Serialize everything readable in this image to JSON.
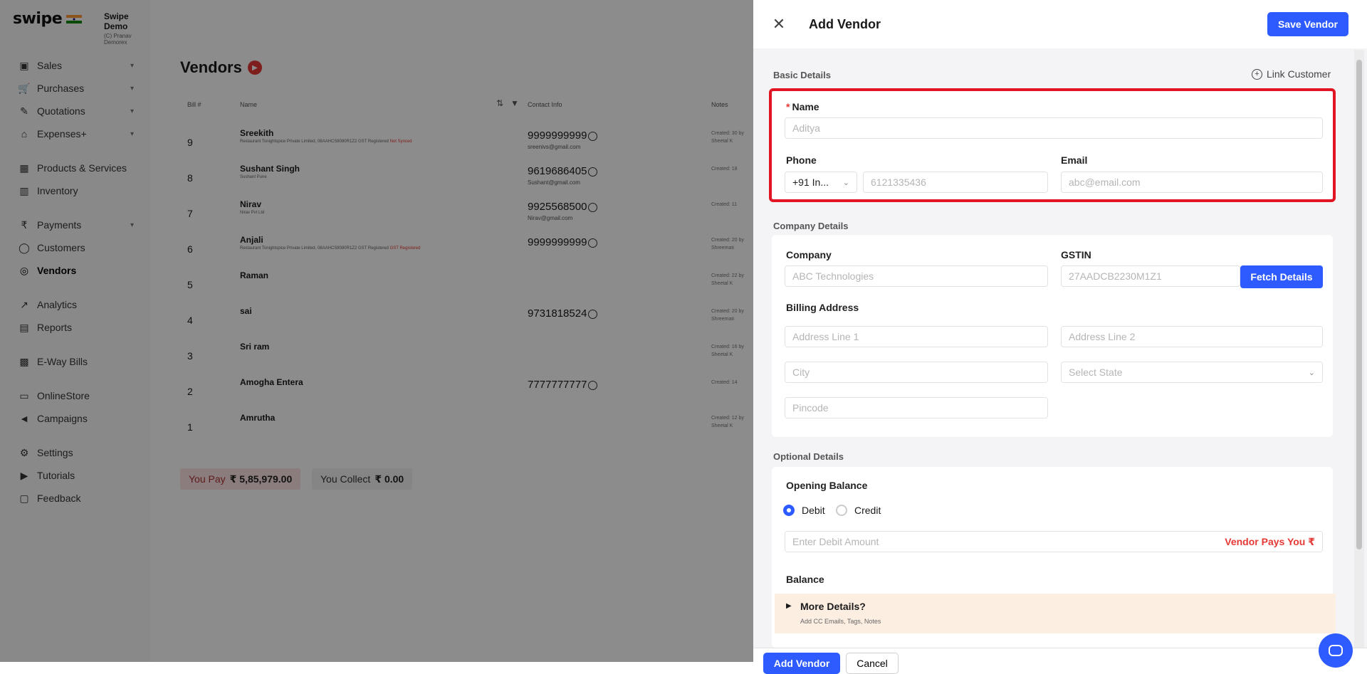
{
  "brand": {
    "logo": "swipe",
    "org_name": "Swipe Demo",
    "org_sub": "(C) Pranav Demorex"
  },
  "sidebar": {
    "items": [
      {
        "label": "Sales",
        "icon": "sales-icon",
        "chev": true
      },
      {
        "label": "Purchases",
        "icon": "cart-icon",
        "chev": true
      },
      {
        "label": "Quotations",
        "icon": "pen-icon",
        "chev": true
      },
      {
        "label": "Expenses+",
        "icon": "tag-icon",
        "chev": true
      },
      {
        "label": "Products & Services",
        "icon": "products-icon",
        "chev": false
      },
      {
        "label": "Inventory",
        "icon": "inventory-icon",
        "chev": false
      },
      {
        "label": "Payments",
        "icon": "rupee-icon",
        "chev": true
      },
      {
        "label": "Customers",
        "icon": "user-icon",
        "chev": false
      },
      {
        "label": "Vendors",
        "icon": "users-icon",
        "chev": false
      },
      {
        "label": "Analytics",
        "icon": "analytics-icon",
        "chev": false
      },
      {
        "label": "Reports",
        "icon": "report-icon",
        "chev": false
      },
      {
        "label": "E-Way Bills",
        "icon": "truck-icon",
        "chev": false
      },
      {
        "label": "OnlineStore",
        "icon": "store-icon",
        "chev": false
      },
      {
        "label": "Campaigns",
        "icon": "megaphone-icon",
        "chev": false
      },
      {
        "label": "Settings",
        "icon": "gear-icon",
        "chev": false
      },
      {
        "label": "Tutorials",
        "icon": "youtube-icon",
        "chev": false
      },
      {
        "label": "Feedback",
        "icon": "feedback-icon",
        "chev": false
      }
    ]
  },
  "page": {
    "title": "Vendors"
  },
  "table": {
    "columns": [
      "Bill #",
      "Name",
      "Contact Info",
      "Notes"
    ],
    "rows": [
      {
        "num": "9",
        "name": "Sreekith",
        "sub": "Restaurant Tonightspice Private Limited, 08AAHCS8080R1Z2 GST Registered",
        "subRed": "Not Synced",
        "phone": "9999999999",
        "email": "sreenivs@gmail.com",
        "notes": "Created: 30 by Sheetal K"
      },
      {
        "num": "8",
        "name": "Sushant Singh",
        "sub": "Sushant Pune",
        "subRed": "",
        "phone": "9619686405",
        "email": "Sushant@gmail.com",
        "notes": "Created: 18"
      },
      {
        "num": "7",
        "name": "Nirav",
        "sub": "Nirav Pvt Ltd",
        "subRed": "",
        "phone": "9925568500",
        "email": "Nirav@gmail.com",
        "notes": "Created: 11"
      },
      {
        "num": "6",
        "name": "Anjali",
        "sub": "Restaurant Tonightspice Private Limited, 08AAHCS8080R1Z2 GST Registered",
        "subRed": "GST Registered",
        "phone": "9999999999",
        "email": "",
        "notes": "Created: 20 by Shreemati"
      },
      {
        "num": "5",
        "name": "Raman",
        "sub": "",
        "subRed": "",
        "phone": "",
        "email": "",
        "notes": "Created: 22 by Sheetal K"
      },
      {
        "num": "4",
        "name": "sai",
        "sub": "",
        "subRed": "",
        "phone": "9731818524",
        "email": "",
        "notes": "Created: 20 by Shreemati"
      },
      {
        "num": "3",
        "name": "Sri ram",
        "sub": "",
        "subRed": "",
        "phone": "",
        "email": "",
        "notes": "Created: 16 by Sheetal K"
      },
      {
        "num": "2",
        "name": "Amogha Entera",
        "sub": "",
        "subRed": "",
        "phone": "7777777777",
        "email": "",
        "notes": "Created: 14"
      },
      {
        "num": "1",
        "name": "Amrutha",
        "sub": "",
        "subRed": "",
        "phone": "",
        "email": "",
        "notes": "Created: 12 by Sheetal K"
      }
    ]
  },
  "totals": {
    "you_pay_label": "You Pay",
    "you_pay": "₹ 5,85,979.00",
    "you_collect_label": "You Collect",
    "you_collect": "₹ 0.00"
  },
  "drawer": {
    "title": "Add Vendor",
    "save_label": "Save Vendor",
    "basic_label": "Basic Details",
    "link_customer": "Link Customer",
    "name_label": "Name",
    "name_placeholder": "Aditya",
    "phone_label": "Phone",
    "phone_code": "+91  In...",
    "phone_placeholder": "6121335436",
    "email_label": "Email",
    "email_placeholder": "abc@email.com",
    "company_details_label": "Company Details",
    "company_label": "Company",
    "company_placeholder": "ABC Technologies",
    "gstin_label": "GSTIN",
    "gstin_placeholder": "27AADCB2230M1Z1",
    "fetch_label": "Fetch Details",
    "billing_label": "Billing Address",
    "addr1_placeholder": "Address Line 1",
    "addr2_placeholder": "Address Line 2",
    "city_placeholder": "City",
    "state_placeholder": "Select State",
    "pincode_placeholder": "Pincode",
    "optional_label": "Optional Details",
    "opening_label": "Opening Balance",
    "debit_label": "Debit",
    "credit_label": "Credit",
    "debit_placeholder": "Enter Debit Amount",
    "vendor_pays": "Vendor Pays You ₹",
    "balance_label": "Balance",
    "more_title": "More Details?",
    "more_sub": "Add CC Emails, Tags, Notes",
    "add_label": "Add Vendor",
    "cancel_label": "Cancel"
  },
  "colors": {
    "accent": "#2e5bff",
    "highlight": "#e01422",
    "danger": "#e53935"
  }
}
